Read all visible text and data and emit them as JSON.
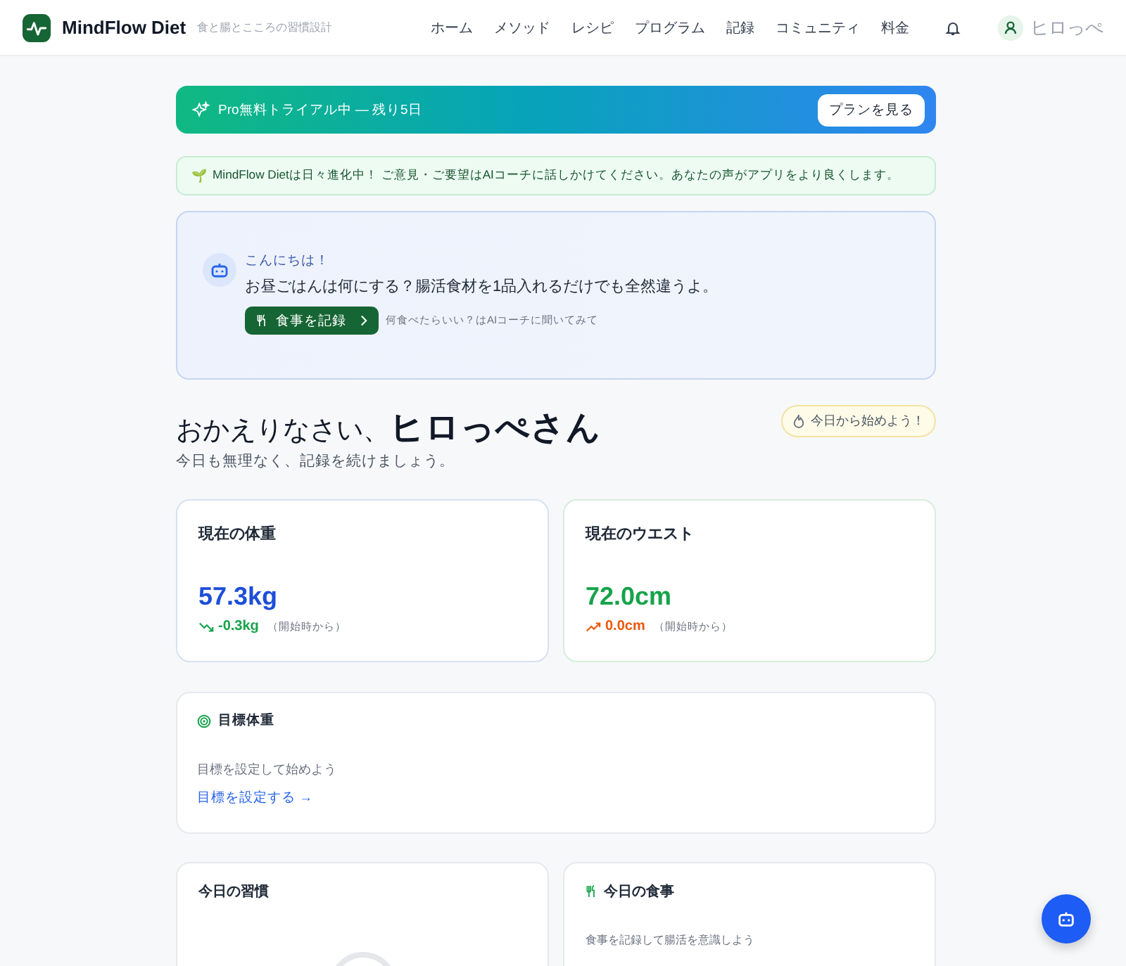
{
  "header": {
    "brand": "MindFlow Diet",
    "tagline": "食と腸とこころの習慣設計",
    "nav": [
      "ホーム",
      "メソッド",
      "レシピ",
      "プログラム",
      "記録",
      "コミュニティ",
      "料金"
    ],
    "user": "ヒロっぺ"
  },
  "trial": {
    "text": "Pro無料トライアル中 — 残り5日",
    "button": "プランを見る"
  },
  "notice": {
    "icon": "🌱",
    "text": "MindFlow Dietは日々進化中！ ご意見・ご要望はAIコーチに話しかけてください。あなたの声がアプリをより良くします。"
  },
  "coach": {
    "greeting": "こんにちは！",
    "message": "お昼ごはんは何にする？腸活食材を1品入れるだけでも全然違うよ。",
    "button": "食事を記録",
    "hint": "何食べたらいい？はAIコーチに聞いてみて"
  },
  "welcome": {
    "title": "おかえりなさい、",
    "name": "ヒロっぺさん",
    "subtitle": "今日も無理なく、記録を続けましょう。",
    "badge": "今日から始めよう！"
  },
  "stats": [
    {
      "label": "現在の体重",
      "value": "57.3kg",
      "color": "#1d4ed8",
      "kind": "down",
      "delta": "-0.3kg",
      "note": "（開始時から）"
    },
    {
      "label": "現在のウエスト",
      "value": "72.0cm",
      "color": "#16a34a",
      "kind": "up",
      "delta": "0.0cm",
      "note": "（開始時から）"
    }
  ],
  "goal": {
    "title": "目標体重",
    "text": "目標を設定して始めよう",
    "link": "目標を設定する →"
  },
  "habits": {
    "title": "今日の習慣"
  },
  "meals": {
    "title": "今日の食事",
    "hint": "食事を記録して腸活を意識しよう"
  }
}
